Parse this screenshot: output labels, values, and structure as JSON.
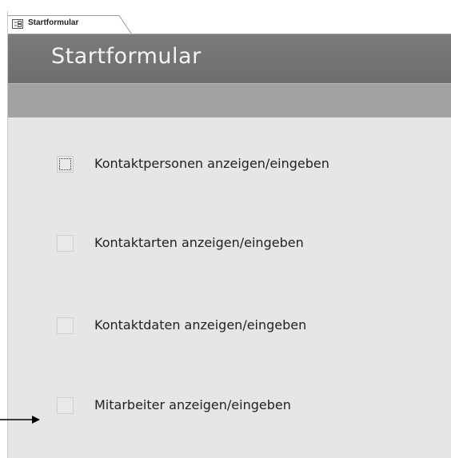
{
  "tab": {
    "label": "Startformular",
    "icon": "form-icon"
  },
  "form": {
    "title": "Startformular",
    "options": [
      {
        "label": "Kontaktpersonen anzeigen/eingeben",
        "checked": false,
        "focused": true
      },
      {
        "label": "Kontaktarten anzeigen/eingeben",
        "checked": false,
        "focused": false
      },
      {
        "label": "Kontaktdaten anzeigen/eingeben",
        "checked": false,
        "focused": false
      },
      {
        "label": "Mitarbeiter anzeigen/eingeben",
        "checked": false,
        "focused": false
      }
    ]
  },
  "colors": {
    "header": "#747474",
    "subbar": "#a2a2a2",
    "body": "#e6e6e6",
    "title_text": "#f4f4f4"
  },
  "annotation": {
    "icon": "arrow-right-icon"
  }
}
